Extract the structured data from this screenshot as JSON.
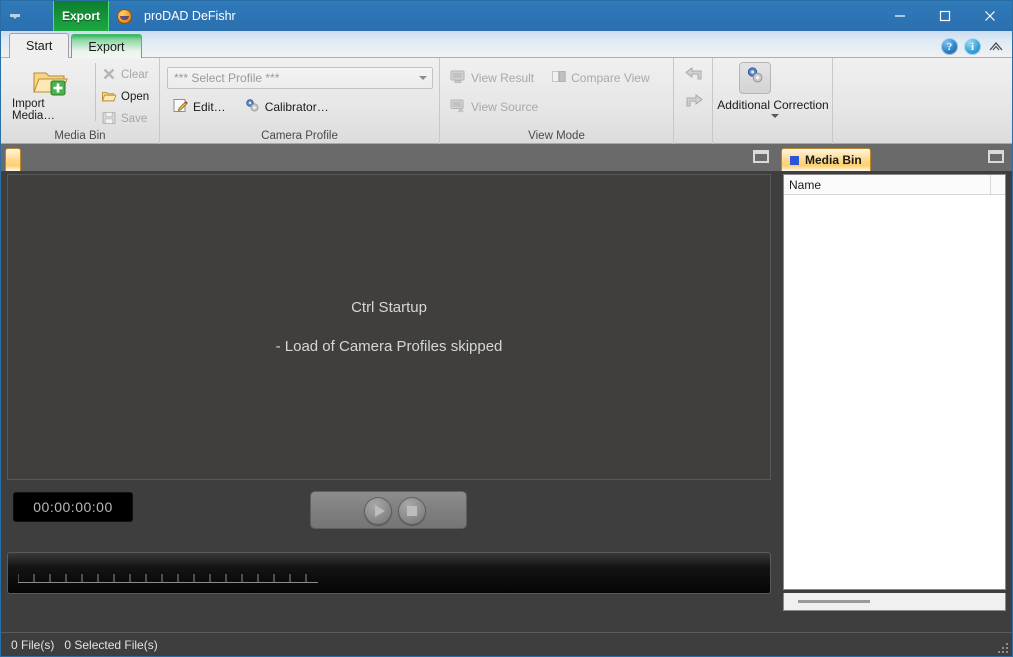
{
  "window": {
    "title": "proDAD DeFishr",
    "quick_access_icon": "dropdown-arrow-icon",
    "app_icon": "prodad-logo-icon",
    "minimize": "minimize-icon",
    "maximize": "maximize-icon",
    "close": "close-icon"
  },
  "title_chip": {
    "label": "Export"
  },
  "tabs": [
    {
      "label": "Start",
      "active": true
    },
    {
      "label": "Export",
      "active": false
    }
  ],
  "help_icons": [
    {
      "name": "help-icon",
      "glyph": "?"
    },
    {
      "name": "info-icon",
      "glyph": "i"
    },
    {
      "name": "home-icon",
      "glyph": "home"
    }
  ],
  "ribbon": {
    "groups": [
      {
        "name": "media-bin",
        "label": "Media Bin",
        "big_button": {
          "label": "Import Media…",
          "icon": "folder-add-icon",
          "enabled": true
        },
        "stack_buttons": [
          {
            "label": "Clear",
            "icon": "clear-x-icon",
            "enabled": false
          },
          {
            "label": "Open",
            "icon": "folder-open-icon",
            "enabled": true
          },
          {
            "label": "Save",
            "icon": "floppy-save-icon",
            "enabled": false
          }
        ]
      },
      {
        "name": "camera-profile",
        "label": "Camera Profile",
        "combo": {
          "value": "*** Select Profile ***",
          "icon": "chevron-down-icon"
        },
        "buttons": [
          {
            "label": "Edit…",
            "icon": "pencil-edit-icon",
            "enabled": true
          },
          {
            "label": "Calibrator…",
            "icon": "gears-icon",
            "enabled": true
          }
        ]
      },
      {
        "name": "view-mode",
        "label": "View Mode",
        "items": [
          {
            "label": "View Result",
            "icon": "monitor-icon",
            "enabled": false
          },
          {
            "label": "Compare View",
            "icon": "split-view-icon",
            "enabled": false
          },
          {
            "label": "View Source",
            "icon": "monitor-source-icon",
            "enabled": false
          }
        ]
      },
      {
        "name": "history-arrows",
        "label": "",
        "items": [
          {
            "label": "",
            "icon": "undo-arrow-icon",
            "enabled": false
          },
          {
            "label": "",
            "icon": "redo-arrow-icon",
            "enabled": false
          }
        ]
      },
      {
        "name": "additional-correction",
        "label": "",
        "button": {
          "label": "Additional Correction",
          "icon": "gears-blue-icon",
          "enabled": true,
          "has_dropdown": true
        }
      }
    ]
  },
  "viewer_panel": {
    "tab_label": "",
    "maximize_icon": "restore-window-icon",
    "messages": [
      "Ctrl Startup",
      "- Load of Camera Profiles skipped"
    ]
  },
  "transport": {
    "timecode": "00:00:00:00",
    "play_button": "play-icon",
    "stop_button": "stop-icon"
  },
  "media_bin": {
    "tab_label": "Media Bin",
    "tab_icon": "blue-square-icon",
    "maximize_icon": "restore-window-icon",
    "columns": [
      "Name"
    ],
    "rows": []
  },
  "status_bar": {
    "file_count": "0 File(s)",
    "selected_count": "0 Selected File(s)",
    "grip": "resize-grip-icon"
  },
  "colors": {
    "titlebar": "#2d74b4",
    "export_green": "#1fa843",
    "ribbon_bg": "#e9e9e9",
    "workspace_bg": "#3e3e3e",
    "viewer_bg": "#403f3e",
    "tab_orange": "#ffd98a",
    "accent_blue": "#2a56d8"
  }
}
